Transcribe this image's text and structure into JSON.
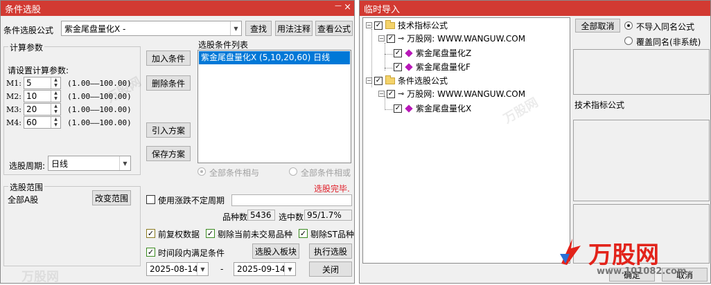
{
  "left_window": {
    "title": "条件选股",
    "close_glyph": "×",
    "formula_label": "条件选股公式",
    "formula_value": "紫金尾盘量化X  -",
    "find_button": "查找",
    "usage_button": "用法注释",
    "view_formula_button": "查看公式",
    "calc_group_title": "计算参数",
    "param_prompt": "请设置计算参数:",
    "params": [
      {
        "name": "M1:",
        "value": "5",
        "range": "(1.00——100.00)"
      },
      {
        "name": "M2:",
        "value": "10",
        "range": "(1.00——100.00)"
      },
      {
        "name": "M3:",
        "value": "20",
        "range": "(1.00——100.00)"
      },
      {
        "name": "M4:",
        "value": "60",
        "range": "(1.00——100.00)"
      }
    ],
    "period_label": "选股周期:",
    "period_value": "日线",
    "add_condition_button": "加入条件",
    "delete_condition_button": "删除条件",
    "import_scheme_button": "引入方案",
    "save_scheme_button": "保存方案",
    "condition_list_title": "选股条件列表",
    "condition_list_items": [
      "紫金尾盘量化X (5,10,20,60) 日线"
    ],
    "radio_all_and": "全部条件相与",
    "radio_all_or": "全部条件相或",
    "status_text": "选股完毕.",
    "scope_group_title": "选股范围",
    "scope_value": "全部A股",
    "change_scope_button": "改变范围",
    "use_variable_period_label": "使用涨跌不定周期",
    "variety_count_label": "品种数",
    "variety_count_value": "5436",
    "selected_count_label": "选中数",
    "selected_count_value": "95/1.7%",
    "fq_label": "前复权数据",
    "remove_untraded_label": "剔除当前未交易品种",
    "remove_st_label": "剔除ST品种",
    "time_range_label": "时间段内满足条件",
    "to_block_button": "选股入板块",
    "execute_button": "执行选股",
    "date_start": "2025-08-14",
    "date_separator": "-",
    "date_end": "2025-09-14",
    "close_button": "关闭"
  },
  "right_window": {
    "title": "临时导入",
    "tree": [
      {
        "label": "技术指标公式",
        "type": "folder"
      },
      {
        "label": "万股网: WWW.WANGUW.COM",
        "type": "key"
      },
      {
        "label": "紫金尾盘量化Z",
        "type": "formula"
      },
      {
        "label": "紫金尾盘量化F",
        "type": "formula"
      },
      {
        "label": "条件选股公式",
        "type": "folder"
      },
      {
        "label": "万股网: WWW.WANGUW.COM",
        "type": "key"
      },
      {
        "label": "紫金尾盘量化X",
        "type": "formula"
      }
    ],
    "cancel_all_button": "全部取消",
    "radio_no_import_same": "不导入同名公式",
    "radio_overwrite_same": "覆盖同名(非系统)",
    "type_label": "技术指标公式",
    "ok_button": "确定",
    "cancel_button": "取消"
  },
  "watermarks": {
    "brand_text": "万股网",
    "site_text": "www.101082.com",
    "faint_mark": "万股网"
  },
  "colors": {
    "titlebar": "#d23a32",
    "selection": "#0078d7",
    "status": "#e0202a"
  }
}
